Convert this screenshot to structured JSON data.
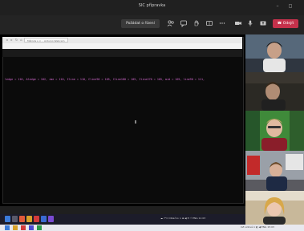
{
  "window": {
    "title": "SIC přípravka",
    "min_symbol": "–",
    "max_symbol": "◻"
  },
  "toolbar": {
    "join_label": "Požádat o řízení",
    "leave_label": "Odejít",
    "leave_icon": "phone-hangup-icon"
  },
  "shared_screen": {
    "tab_label": "Mětoda s × ·· Arduino Webcam",
    "code_line": "ledge = 110, Aledge = 102, ime = 110, Iline = 110, Cline90 = 105, Cline180 = 105, Iline270 = 105, mid = 105, line90 = 111,"
  },
  "taskbar": {
    "tray_text": "☁  7°C  Oblačno  ∧  ⊞  ◀  ✉  ⚡  ENG  11:03"
  },
  "teams_bottom": {
    "text": "CZ  Lidová  ∧  ◐  ◀  ENG  15:03"
  },
  "participants": [
    {
      "name": ""
    },
    {
      "name": ""
    },
    {
      "name": ""
    },
    {
      "name": ""
    },
    {
      "name": ""
    }
  ]
}
